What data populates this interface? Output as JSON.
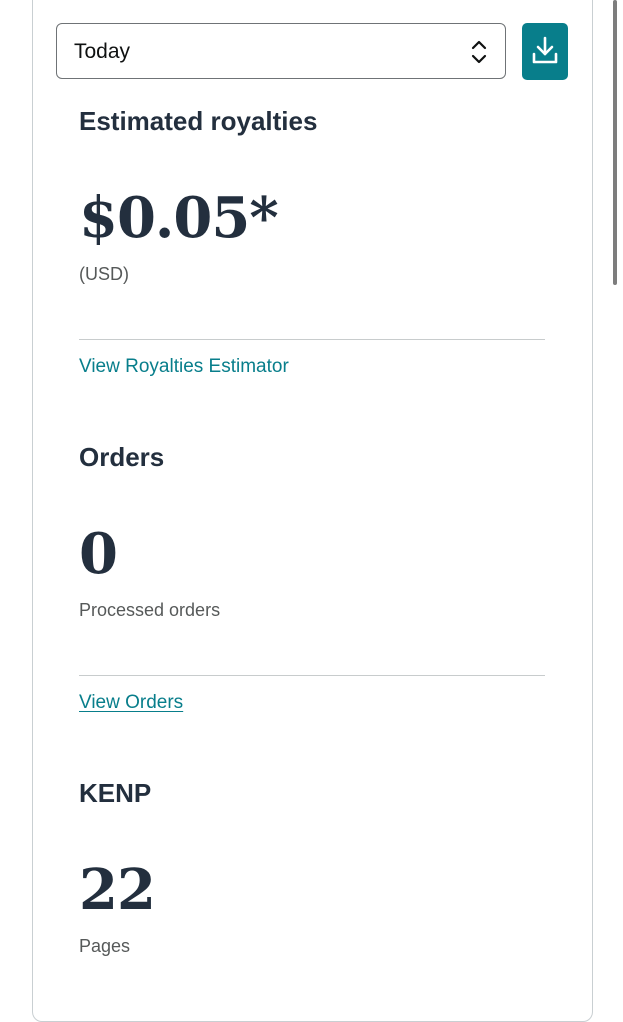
{
  "period_select": {
    "selected": "Today"
  },
  "download_button": {
    "icon": "download-icon"
  },
  "royalties": {
    "heading": "Estimated royalties",
    "value": "$0.05*",
    "currency": "(USD)",
    "link": "View Royalties Estimator"
  },
  "orders": {
    "heading": "Orders",
    "value": "0",
    "sublabel": "Processed orders",
    "link": "View Orders"
  },
  "kenp": {
    "heading": "KENP",
    "value": "22",
    "sublabel": "Pages"
  },
  "colors": {
    "accent": "#087e8b",
    "heading": "#232f3e",
    "muted": "#565959"
  }
}
